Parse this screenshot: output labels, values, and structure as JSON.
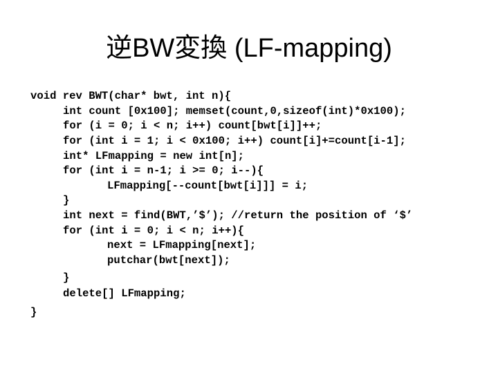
{
  "slide": {
    "title": "逆BW変換 (LF-mapping)",
    "code_lines": [
      "void rev BWT(char* bwt, int n){",
      "int count [0x100]; memset(count,0,sizeof(int)*0x100);",
      "for (i = 0; i < n; i++) count[bwt[i]]++;",
      "for (int i = 1; i < 0x100; i++) count[i]+=count[i-1];",
      "int* LFmapping = new int[n];",
      "for (int i = n-1; i >= 0; i--){",
      "LFmapping[--count[bwt[i]]] = i;",
      "}",
      "int next = find(BWT,’$’); //return the position of ‘$’",
      "for (int i = 0; i < n; i++){",
      "next = LFmapping[next];",
      "putchar(bwt[next]);",
      "}",
      "delete[] LFmapping;",
      "}"
    ]
  }
}
